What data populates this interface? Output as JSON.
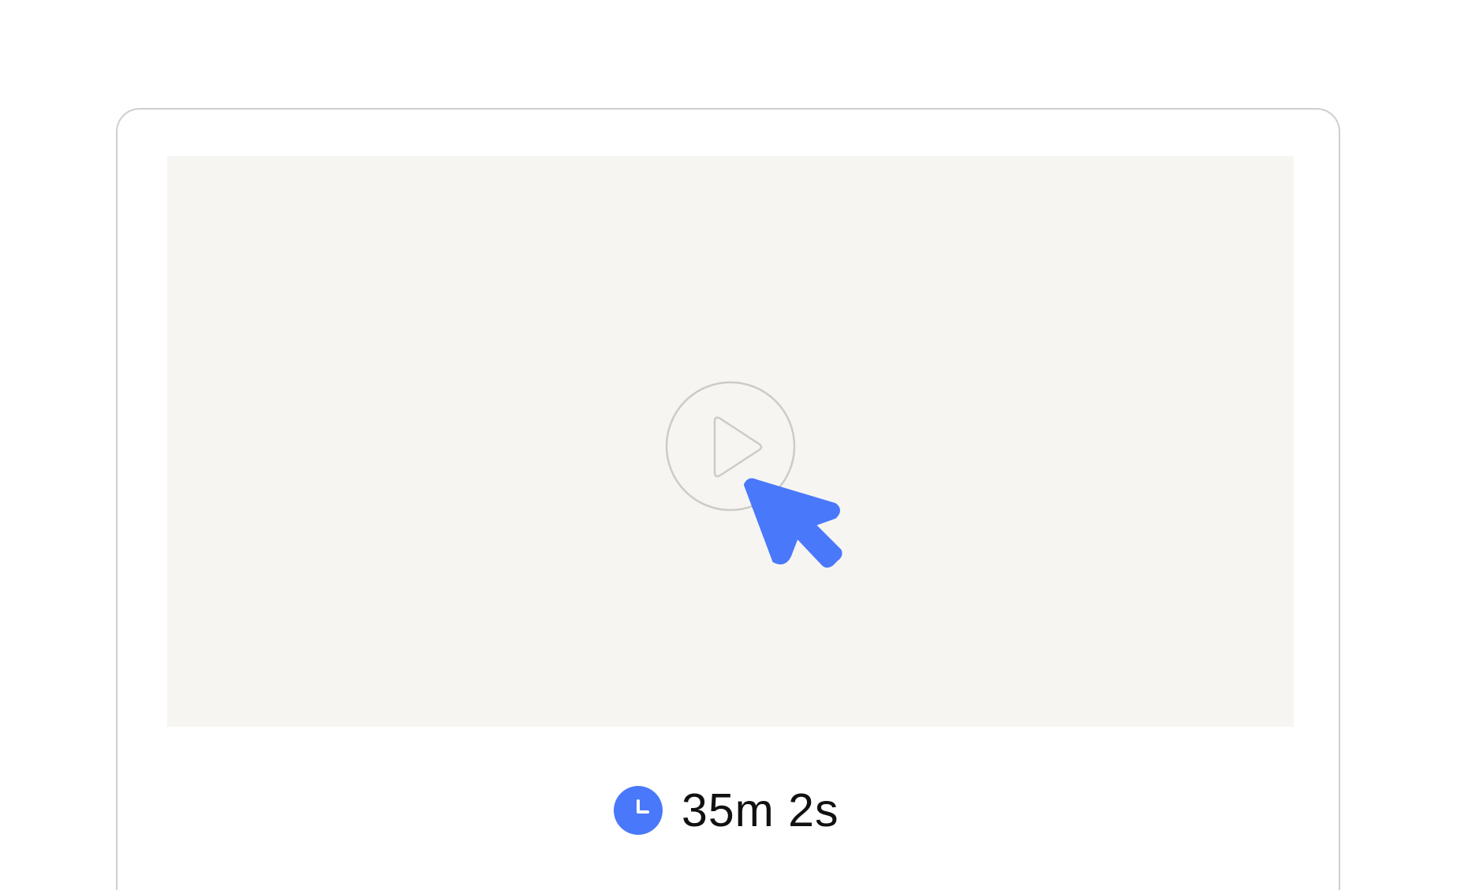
{
  "video": {
    "play_icon": "play-icon",
    "cursor_icon": "cursor-arrow-icon"
  },
  "duration": {
    "icon": "clock-icon",
    "value": "35m 2s"
  },
  "colors": {
    "accent": "#4a78fb",
    "video_background": "#f6f5f2",
    "card_border": "#cfcfcf",
    "play_outline": "#cdcbc8",
    "text": "#111111"
  }
}
